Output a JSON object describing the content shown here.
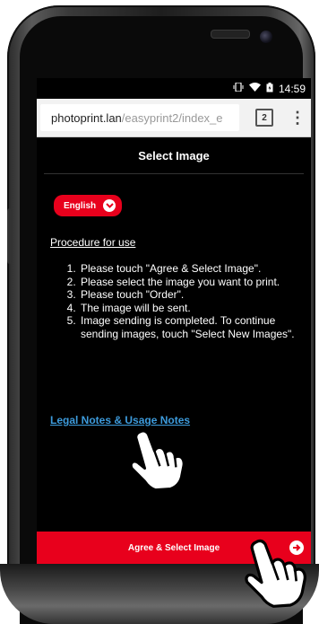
{
  "status": {
    "time": "14:59",
    "signal_icon": "vibrate-icon",
    "wifi_icon": "wifi-icon",
    "battery_icon": "battery-icon"
  },
  "browser": {
    "url_host": "photoprint.lan",
    "url_path": "/easyprint2/index_e",
    "tab_count": "2"
  },
  "page": {
    "title": "Select Image",
    "language": "English",
    "procedure_title": "Procedure for use",
    "steps": [
      "Please touch \"Agree & Select Image\".",
      "Please select the image you want to print.",
      "Please touch \"Order\".",
      "The image will be sent.",
      "Image sending is completed. To continue sending images, touch \"Select New Images\"."
    ],
    "legal_link": "Legal Notes & Usage Notes",
    "agree_button": "Agree & Select Image"
  },
  "colors": {
    "accent": "#e8001c",
    "link": "#3d9bdc",
    "background": "#000000"
  }
}
